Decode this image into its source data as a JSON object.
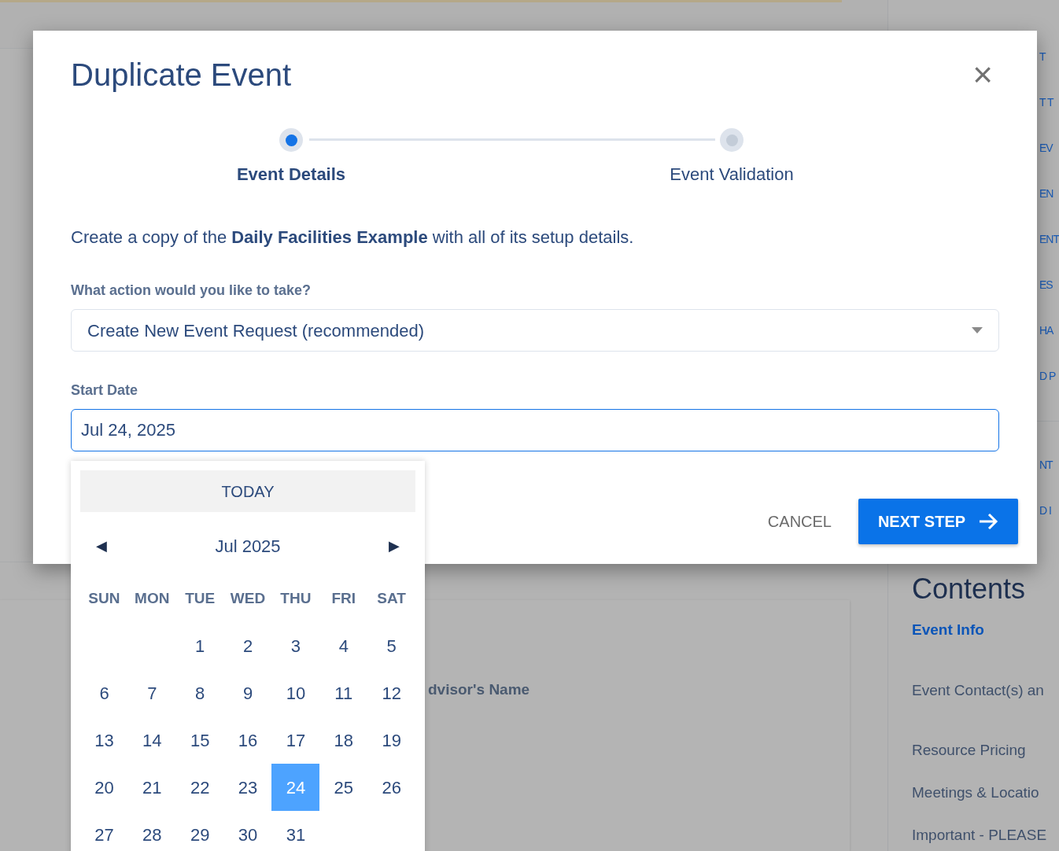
{
  "background": {
    "card_label": "dvisor's Name",
    "sidebar_fragments": [
      "T",
      "T T",
      "EV",
      "EN",
      "ENT",
      "ES",
      "HA",
      "D P",
      "NT",
      "D I"
    ],
    "contents": {
      "title": "Contents",
      "items": [
        {
          "label": "Event Info",
          "selected": true
        },
        {
          "label": "Event Contact(s) an",
          "selected": false
        },
        {
          "label": "Resource Pricing",
          "selected": false
        },
        {
          "label": "Meetings & Locatio",
          "selected": false
        },
        {
          "label": "Important - PLEASE",
          "selected": false
        }
      ]
    }
  },
  "dialog": {
    "title": "Duplicate Event",
    "close": "×",
    "steps": [
      {
        "label": "Event Details",
        "selected": true
      },
      {
        "label": "Event Validation",
        "selected": false
      }
    ],
    "description": "Create a copy of the **Daily Facilities Example** with all of its setup details.",
    "action": {
      "label": "What action would you like to take?",
      "value": "Create New Event Request (recommended)"
    },
    "start_date": {
      "label": "Start Date",
      "value": "Jul 24, 2025"
    },
    "buttons": {
      "cancel": "CANCEL",
      "next": "NEXT STEP"
    },
    "datepicker": {
      "today": "TODAY",
      "prev": "◀",
      "month": "Jul 2025",
      "next": "▶",
      "weekdays": [
        "SUN",
        "MON",
        "TUE",
        "WED",
        "THU",
        "FRI",
        "SAT"
      ],
      "weeks": [
        [
          {
            "label": "1",
            "selected": false
          },
          {
            "label": "2",
            "selected": false
          },
          {
            "label": "3",
            "selected": false
          },
          {
            "label": "4",
            "selected": false
          },
          {
            "label": "5",
            "selected": false
          }
        ],
        [
          {
            "label": "6",
            "selected": false
          },
          {
            "label": "7",
            "selected": false
          },
          {
            "label": "8",
            "selected": false
          },
          {
            "label": "9",
            "selected": false
          },
          {
            "label": "10",
            "selected": false
          },
          {
            "label": "11",
            "selected": false
          },
          {
            "label": "12",
            "selected": false
          }
        ],
        [
          {
            "label": "13",
            "selected": false
          },
          {
            "label": "14",
            "selected": false
          },
          {
            "label": "15",
            "selected": false
          },
          {
            "label": "16",
            "selected": false
          },
          {
            "label": "17",
            "selected": false
          },
          {
            "label": "18",
            "selected": false
          },
          {
            "label": "19",
            "selected": false
          }
        ],
        [
          {
            "label": "20",
            "selected": false
          },
          {
            "label": "21",
            "selected": false
          },
          {
            "label": "22",
            "selected": false
          },
          {
            "label": "23",
            "selected": false
          },
          {
            "label": "24",
            "selected": true
          },
          {
            "label": "25",
            "selected": false
          },
          {
            "label": "26",
            "selected": false
          }
        ],
        [
          {
            "label": "27",
            "selected": false
          },
          {
            "label": "28",
            "selected": false
          },
          {
            "label": "29",
            "selected": false
          },
          {
            "label": "30",
            "selected": false
          },
          {
            "label": "31",
            "selected": false
          }
        ]
      ]
    }
  }
}
